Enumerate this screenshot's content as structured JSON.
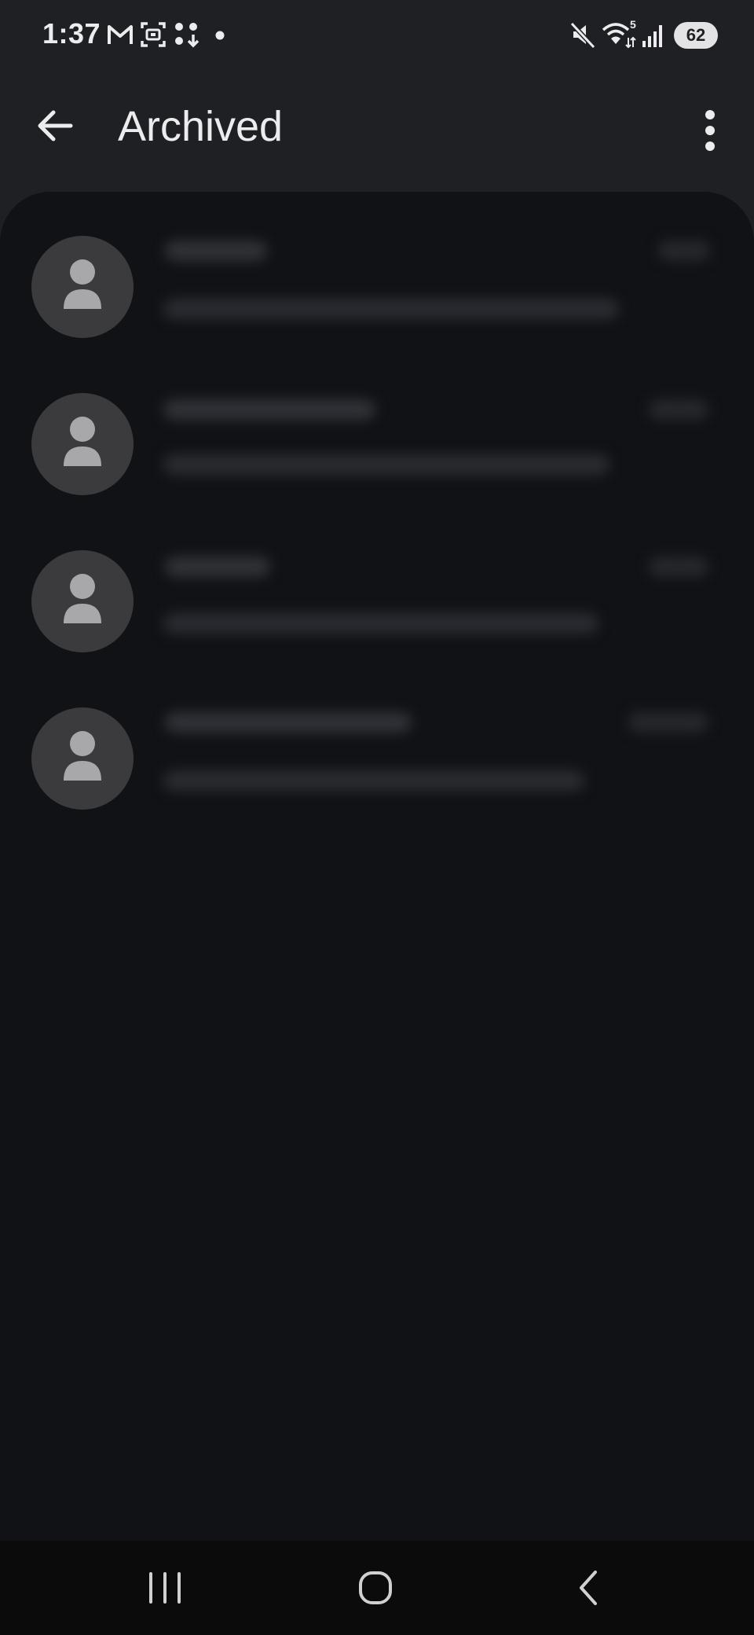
{
  "status_bar": {
    "time": "1:37",
    "left_icons": [
      "gmail-icon",
      "screen-record-icon",
      "download-icon",
      "notification-dot-icon"
    ],
    "right_icons": [
      "mute-icon",
      "wifi-icon",
      "signal-icon"
    ],
    "wifi_badge": "5",
    "battery": "62"
  },
  "app_bar": {
    "title": "Archived",
    "back_icon": "arrow-back-icon",
    "more_icon": "more-vert-icon"
  },
  "conversations": {
    "avatar_icon": "person-icon",
    "items": [
      {
        "state": "blurred"
      },
      {
        "state": "blurred"
      },
      {
        "state": "blurred"
      },
      {
        "state": "blurred"
      }
    ]
  },
  "nav_bar": {
    "icons": [
      "recent-apps-icon",
      "home-icon",
      "nav-back-icon"
    ]
  },
  "colors": {
    "app_background": "#1e2024",
    "list_background": "#101216",
    "avatar_background": "#3b3b3e",
    "avatar_glyph": "#a8a8ab",
    "text_primary": "#ececee",
    "nav_background": "#0b0b0c"
  }
}
